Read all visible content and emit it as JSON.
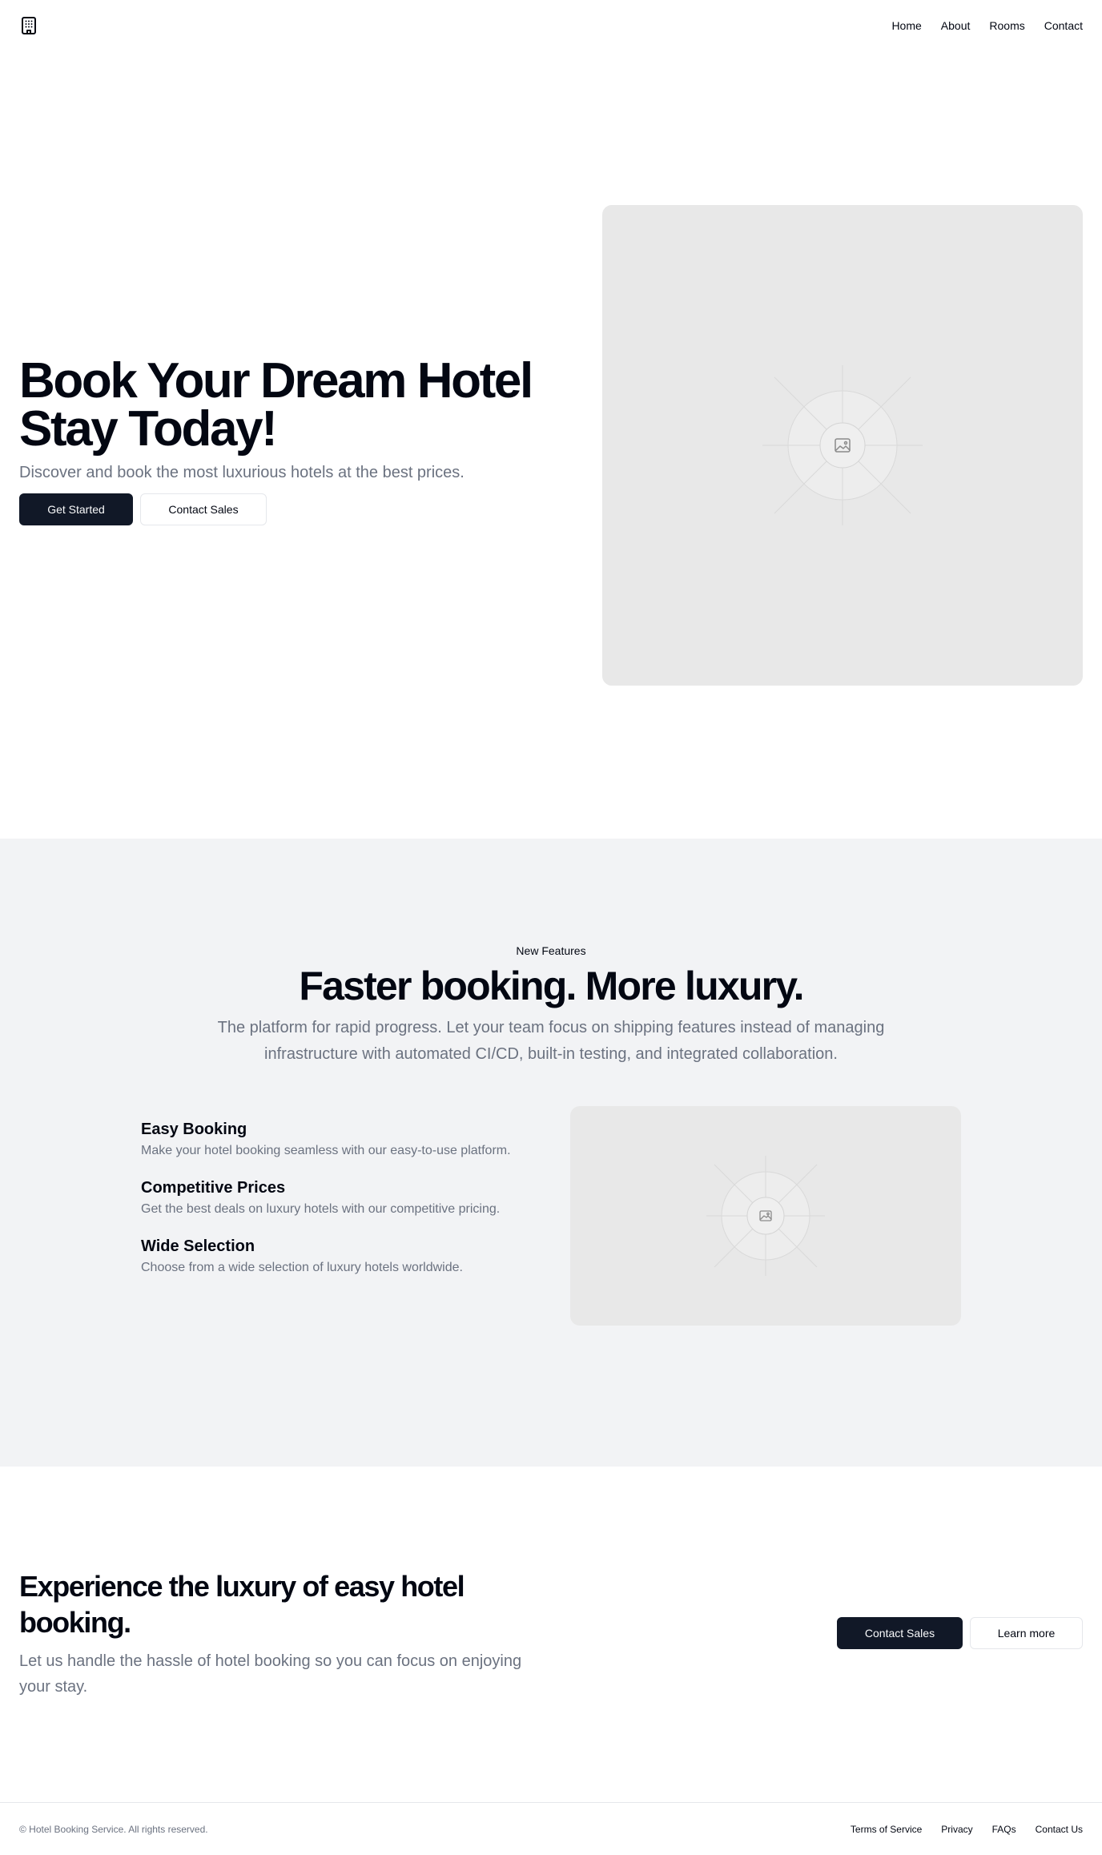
{
  "header": {
    "logo_icon": "building-icon",
    "nav": [
      "Home",
      "About",
      "Rooms",
      "Contact"
    ]
  },
  "hero": {
    "title_line1": "Book Your Dream Hotel",
    "title_line2": "Stay Today!",
    "subtitle": "Discover and book the most luxurious hotels at the best prices.",
    "primary_button": "Get Started",
    "secondary_button": "Contact Sales",
    "image_icon": "image-placeholder-icon"
  },
  "features": {
    "eyebrow": "New Features",
    "title": "Faster booking. More luxury.",
    "subtitle": "The platform for rapid progress. Let your team focus on shipping features instead of managing infrastructure with automated CI/CD, built-in testing, and integrated collaboration.",
    "items": [
      {
        "title": "Easy Booking",
        "description": "Make your hotel booking seamless with our easy-to-use platform."
      },
      {
        "title": "Competitive Prices",
        "description": "Get the best deals on luxury hotels with our competitive pricing."
      },
      {
        "title": "Wide Selection",
        "description": "Choose from a wide selection of luxury hotels worldwide."
      }
    ]
  },
  "cta": {
    "title": "Experience the luxury of easy hotel booking.",
    "subtitle": "Let us handle the hassle of hotel booking so you can focus on enjoying your stay.",
    "primary_button": "Contact Sales",
    "secondary_button": "Learn more"
  },
  "footer": {
    "copyright": "© Hotel Booking Service. All rights reserved.",
    "links": [
      "Terms of Service",
      "Privacy",
      "FAQs",
      "Contact Us"
    ]
  },
  "colors": {
    "primary": "#111827",
    "muted_text": "#6b7280",
    "section_bg": "#f2f3f5",
    "placeholder_bg": "#e8e8e8"
  }
}
